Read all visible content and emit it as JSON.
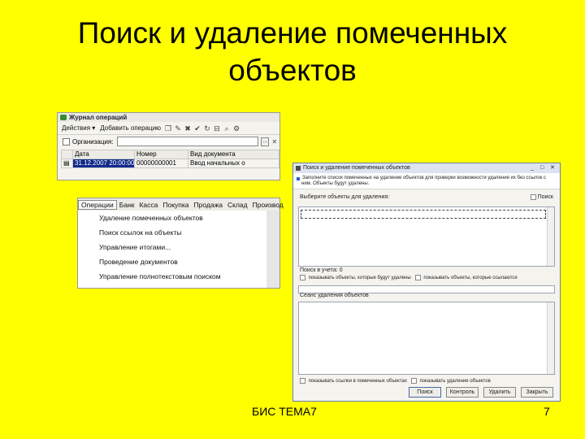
{
  "slide": {
    "title_line1": "Поиск и удаление помеченных",
    "title_line2": "объектов",
    "footer_center": "БИС ТЕМА7",
    "page_number": "7"
  },
  "journal_window": {
    "title": "Журнал операций",
    "toolbar": {
      "actions_label": "Действия ▾",
      "add_label": "Добавить операцию"
    },
    "org_label": "Организация:",
    "org_clear": "✕",
    "table": {
      "columns": [
        "",
        "Дата",
        "Номер",
        "Вид документа"
      ],
      "row": {
        "date": "31.12.2007 20:00:00",
        "number": "00000000001",
        "doc_type": "Ввод начальных о"
      }
    }
  },
  "operations_menu": {
    "menubar": [
      "Операции",
      "Банк",
      "Касса",
      "Покупка",
      "Продажа",
      "Склад",
      "Производ"
    ],
    "items": [
      "Удаление помеченных объектов",
      "Поиск ссылок на объекты",
      "Управление итогами...",
      "Проведение документов",
      "Управление полнотекстовым поиском"
    ]
  },
  "delete_dialog": {
    "title": "Поиск и удаление помеченных объектов",
    "window_controls": "_ □ ✕",
    "info": "Заполните список помеченных на удаление объектов для проверки возможности удаления их без ссылок с ним. Объекты будут удалены.",
    "select_label": "Выберите объекты для удаления:",
    "search_label": "Поиск",
    "found_refs_label": "Поиск в учета: 0",
    "opt_show_marked": "показывать объекты, которые будут удалены",
    "opt_show_refs": "показывать объекты, которые ссылаются",
    "log_label": "Сеанс удаления объектов",
    "bottom_opt1": "показывать ссылки в помеченных объектах",
    "bottom_opt2": "показывать удаление объектов",
    "buttons": {
      "search": "Поиск",
      "check": "Контроль",
      "delete": "Удалить",
      "close": "Закрыть"
    }
  }
}
